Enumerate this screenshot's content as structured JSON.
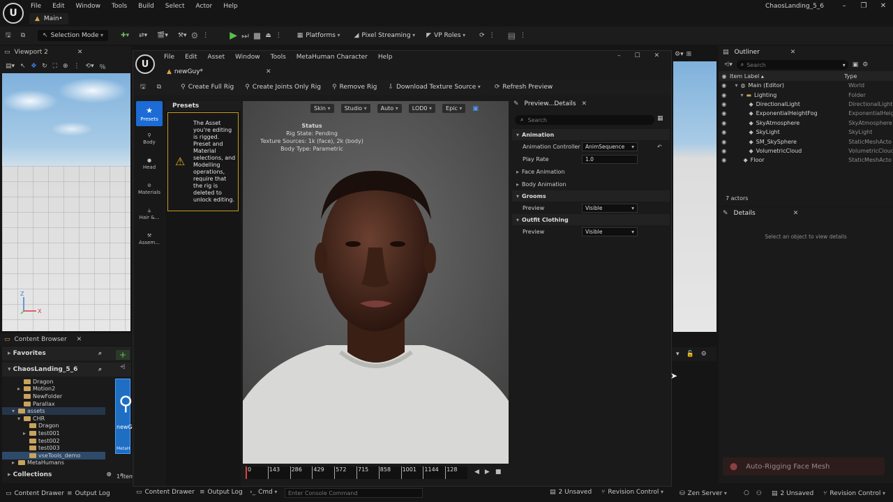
{
  "main_window": {
    "menu": [
      "File",
      "Edit",
      "Window",
      "Tools",
      "Build",
      "Select",
      "Actor",
      "Help"
    ],
    "tab": "Main•",
    "project": "ChaosLanding_5_6"
  },
  "toolbar": {
    "selection_mode": "Selection Mode",
    "platforms": "Platforms",
    "pixel_streaming": "Pixel Streaming",
    "vp_roles": "VP Roles"
  },
  "viewport2": {
    "tab": "Viewport 2",
    "axis_z": "Z",
    "axis_x": "X"
  },
  "content_browser": {
    "tab": "Content Browser",
    "favorites": "Favorites",
    "project": "ChaosLanding_5_6",
    "items": [
      {
        "label": "Dragon",
        "indent": 2,
        "arrow": ""
      },
      {
        "label": "Motion2",
        "indent": 2,
        "arrow": "▸"
      },
      {
        "label": "NewFolder",
        "indent": 2,
        "arrow": ""
      },
      {
        "label": "Parallax",
        "indent": 2,
        "arrow": ""
      },
      {
        "label": "assets",
        "indent": 1,
        "arrow": "▾"
      },
      {
        "label": "CHR",
        "indent": 2,
        "arrow": "▾"
      },
      {
        "label": "Dragon",
        "indent": 3,
        "arrow": ""
      },
      {
        "label": "test001",
        "indent": 3,
        "arrow": "▸"
      },
      {
        "label": "test002",
        "indent": 3,
        "arrow": ""
      },
      {
        "label": "test003",
        "indent": 3,
        "arrow": ""
      },
      {
        "label": "vseTools_demo",
        "indent": 3,
        "arrow": ""
      },
      {
        "label": "MetaHumans",
        "indent": 1,
        "arrow": "▸"
      }
    ],
    "collections": "Collections",
    "asset_label": "newG",
    "asset_type": "MetaH",
    "items_count": "1 item"
  },
  "statusbar": {
    "content_drawer": "Content Drawer",
    "output_log": "Output Log",
    "cmd": "Cmd",
    "console_placeholder": "Enter Console Command",
    "unsaved": "2 Unsaved",
    "revision_control": "Revision Control",
    "zen_server": "Zen Server",
    "unsaved_r": "2 Unsaved",
    "revision_control_r": "Revision Control"
  },
  "metahuman": {
    "menu": [
      "File",
      "Edit",
      "Asset",
      "Window",
      "Tools",
      "MetaHuman Character",
      "Help"
    ],
    "tab": "newGuy*",
    "toolbar": {
      "create_full_rig": "Create Full Rig",
      "create_joints_rig": "Create Joints Only Rig",
      "remove_rig": "Remove Rig",
      "download_texture": "Download Texture Source",
      "refresh_preview": "Refresh Preview"
    },
    "sidebar": [
      "Presets",
      "Body",
      "Head",
      "Materials",
      "Hair &...",
      "Assem..."
    ],
    "presets_title": "Presets",
    "warning": "The Asset you're editing is rigged. Preset and Material selections, and Modelling operations, require that the rig is deleted to unlock editing.",
    "view_toolbar": [
      "Skin",
      "Studio",
      "Auto",
      "LOD0",
      "Epic"
    ],
    "status": {
      "title": "Status",
      "rig_state": "Rig State: Pending",
      "texture_sources": "Texture Sources: 1k (face), 2k (body)",
      "body_type": "Body Type: Parametric"
    },
    "timeline_ticks": [
      "0",
      "143",
      "286",
      "429",
      "572",
      "715",
      "858",
      "1001",
      "1144",
      "128"
    ],
    "details": {
      "tab": "Preview...Details",
      "search_placeholder": "Search",
      "animation": "Animation",
      "anim_controller": "Animation Controller",
      "anim_controller_value": "AnimSequence",
      "play_rate": "Play Rate",
      "play_rate_value": "1.0",
      "face_animation": "Face Animation",
      "body_animation": "Body Animation",
      "grooms": "Grooms",
      "grooms_preview": "Preview",
      "grooms_preview_value": "Visible",
      "outfit": "Outfit Clothing",
      "outfit_preview": "Preview",
      "outfit_preview_value": "Visible"
    }
  },
  "outliner": {
    "tab": "Outliner",
    "search_placeholder": "Search",
    "col_label": "Item Label ▴",
    "col_type": "Type",
    "rows": [
      {
        "name": "Main (Editor)",
        "type": "World",
        "indent": 1,
        "arrow": "▾"
      },
      {
        "name": "Lighting",
        "type": "Folder",
        "indent": 2,
        "arrow": "▾"
      },
      {
        "name": "DirectionalLight",
        "type": "DirectionalLight",
        "indent": 3,
        "arrow": ""
      },
      {
        "name": "ExponentialHeightFog",
        "type": "ExponentialHeig",
        "indent": 3,
        "arrow": ""
      },
      {
        "name": "SkyAtmosphere",
        "type": "SkyAtmosphere",
        "indent": 3,
        "arrow": ""
      },
      {
        "name": "SkyLight",
        "type": "SkyLight",
        "indent": 3,
        "arrow": ""
      },
      {
        "name": "SM_SkySphere",
        "type": "StaticMeshActo",
        "indent": 3,
        "arrow": ""
      },
      {
        "name": "VolumetricCloud",
        "type": "VolumetricCloud",
        "indent": 3,
        "arrow": ""
      },
      {
        "name": "Floor",
        "type": "StaticMeshActo",
        "indent": 2,
        "arrow": ""
      }
    ],
    "actors": "7 actors"
  },
  "details_right": {
    "tab": "Details",
    "message": "Select an object to view details"
  },
  "autorig_toast": "Auto-Rigging Face Mesh"
}
